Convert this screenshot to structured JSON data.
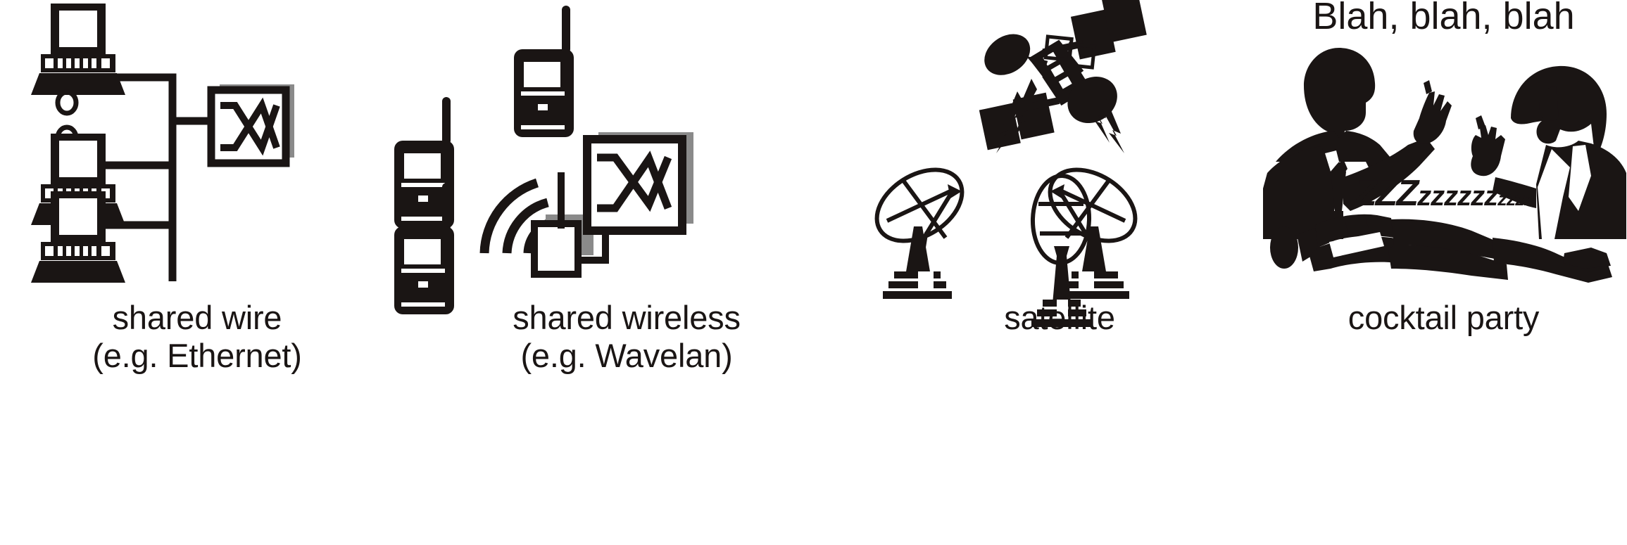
{
  "figure": {
    "title_visible": false,
    "background_color": "#ffffff",
    "ink_color": "#1a1514",
    "shadow_color": "#8a8a8a"
  },
  "panels": [
    {
      "id": "shared-wire",
      "caption_line1": "shared wire",
      "caption_line2": "(e.g. Ethernet)",
      "caption": "shared wire\n(e.g. Ethernet)",
      "icons": [
        "terminal-computer-icon",
        "terminal-computer-icon",
        "terminal-computer-icon",
        "vertical-ellipsis-dots",
        "switch-box-x-icon"
      ],
      "terminal_count": 3,
      "ellipsis_dot_count": 3
    },
    {
      "id": "shared-wireless",
      "caption_line1": "shared wireless",
      "caption_line2": "(e.g. Wavelan)",
      "caption": "shared wireless\n(e.g. Wavelan)",
      "icons": [
        "handheld-radio-icon",
        "handheld-radio-icon",
        "handheld-radio-icon",
        "wireless-waves-icon",
        "access-point-icon",
        "switch-box-x-icon"
      ],
      "handheld_count": 3,
      "wave_arc_count": 3
    },
    {
      "id": "satellite",
      "caption_line1": "satellite",
      "caption_line2": "",
      "caption": "satellite",
      "icons": [
        "satellite-icon",
        "lightning-bolt-icon",
        "lightning-bolt-icon",
        "dish-antenna-icon",
        "dish-antenna-icon",
        "dish-antenna-icon"
      ],
      "dish_count": 3,
      "bolt_count": 2
    },
    {
      "id": "cocktail-party",
      "caption_line1": "cocktail party",
      "caption_line2": "",
      "caption": "cocktail party",
      "speech_text": "Blah, blah, blah",
      "snore_big": "ZZZ",
      "snore_mid": "zzzzzz",
      "snore_small": "zzzz",
      "icons": [
        "talking-man-silhouette-icon",
        "talking-woman-silhouette-icon",
        "sleeping-person-silhouette-icon"
      ]
    }
  ]
}
